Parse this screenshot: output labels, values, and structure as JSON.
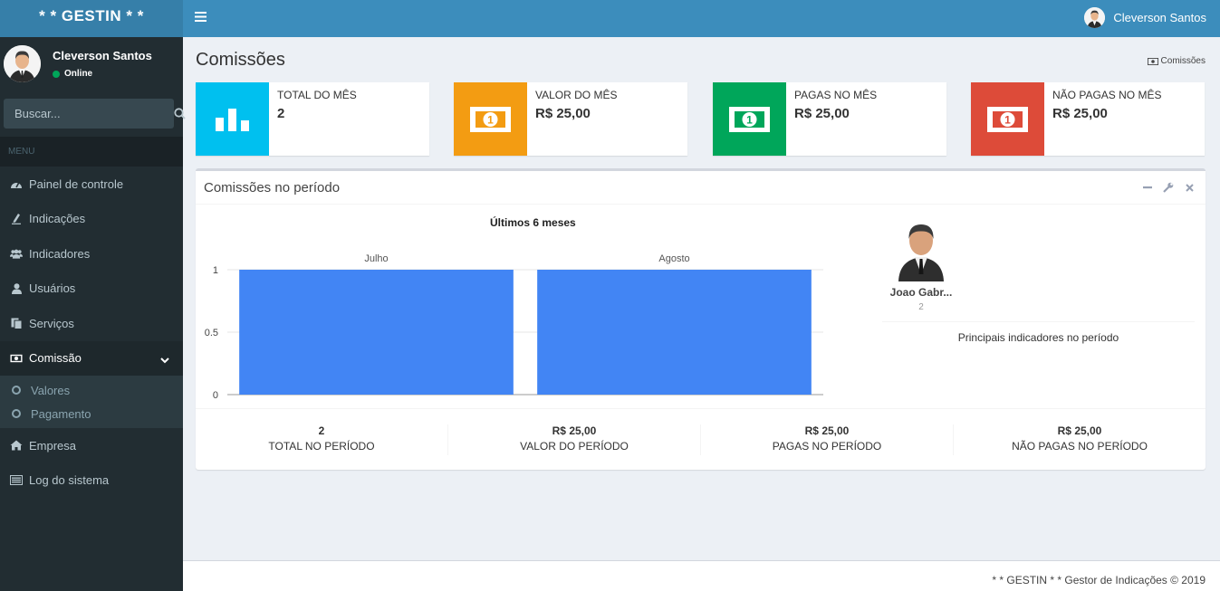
{
  "app": {
    "logo": "* * GESTIN * *"
  },
  "user": {
    "name": "Cleverson Santos",
    "status": "Online"
  },
  "sidebar": {
    "search_placeholder": "Buscar...",
    "menu_header": "MENU",
    "items": [
      {
        "label": "Painel de controle",
        "icon": "dashboard-icon"
      },
      {
        "label": "Indicações",
        "icon": "pencil-icon"
      },
      {
        "label": "Indicadores",
        "icon": "users-icon"
      },
      {
        "label": "Usuários",
        "icon": "user-icon"
      },
      {
        "label": "Serviços",
        "icon": "files-icon"
      },
      {
        "label": "Comissão",
        "icon": "money-icon",
        "active": true
      },
      {
        "label": "Empresa",
        "icon": "home-icon"
      },
      {
        "label": "Log do sistema",
        "icon": "list-icon"
      }
    ],
    "submenu": [
      {
        "label": "Valores"
      },
      {
        "label": "Pagamento"
      }
    ]
  },
  "header": {
    "user_name": "Cleverson Santos"
  },
  "page": {
    "title": "Comissões",
    "breadcrumb": "Comissões"
  },
  "info_boxes": [
    {
      "label": "TOTAL DO MÊS",
      "value": "2",
      "color": "#00c0ef",
      "icon": "bar-chart-icon"
    },
    {
      "label": "VALOR DO MÊS",
      "value": "R$ 25,00",
      "color": "#f39c12",
      "icon": "money-icon"
    },
    {
      "label": "PAGAS NO MÊS",
      "value": "R$ 25,00",
      "color": "#00a65a",
      "icon": "money-icon"
    },
    {
      "label": "NÃO PAGAS NO MÊS",
      "value": "R$ 25,00",
      "color": "#dd4b39",
      "icon": "money-icon"
    }
  ],
  "box": {
    "title": "Comissões no período",
    "chart_title": "Últimos 6 meses"
  },
  "chart_data": {
    "type": "bar",
    "title": "Últimos 6 meses",
    "categories": [
      "Julho",
      "Agosto"
    ],
    "values": [
      1,
      1
    ],
    "yticks": [
      "1",
      "0.5",
      "0"
    ],
    "ylim": [
      0,
      1
    ],
    "color": "#4285f4",
    "grid": true
  },
  "ranking": {
    "people": [
      {
        "name": "Joao Gabr...",
        "count": "2"
      }
    ],
    "caption": "Principais indicadores no período"
  },
  "stats": [
    {
      "value": "2",
      "label": "TOTAL NO PERÍODO"
    },
    {
      "value": "R$ 25,00",
      "label": "VALOR DO PERÍODO"
    },
    {
      "value": "R$ 25,00",
      "label": "PAGAS NO PERÍODO"
    },
    {
      "value": "R$ 25,00",
      "label": "NÃO PAGAS NO PERÍODO"
    }
  ],
  "footer": {
    "text": "* * GESTIN * * Gestor de Indicações © 2019"
  }
}
